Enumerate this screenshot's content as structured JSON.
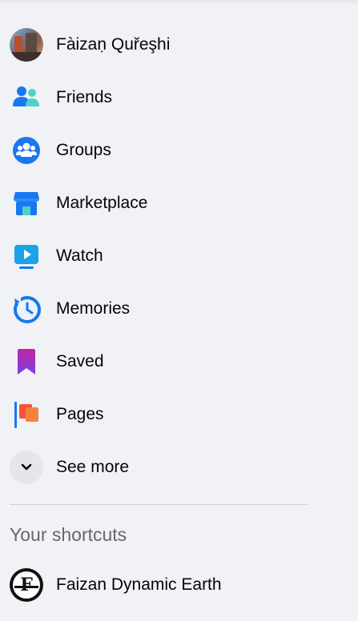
{
  "menu": {
    "items": [
      {
        "label": "Fàizaṇ Quřeşhi",
        "icon": "profile-avatar"
      },
      {
        "label": "Friends",
        "icon": "friends-icon"
      },
      {
        "label": "Groups",
        "icon": "groups-icon"
      },
      {
        "label": "Marketplace",
        "icon": "marketplace-icon"
      },
      {
        "label": "Watch",
        "icon": "watch-icon"
      },
      {
        "label": "Memories",
        "icon": "memories-icon"
      },
      {
        "label": "Saved",
        "icon": "saved-icon"
      },
      {
        "label": "Pages",
        "icon": "pages-icon"
      },
      {
        "label": "See more",
        "icon": "chevron-down-icon"
      }
    ]
  },
  "shortcuts": {
    "title": "Your shortcuts",
    "items": [
      {
        "label": "Faizan Dynamic Earth",
        "icon": "page-logo"
      }
    ]
  },
  "colors": {
    "background": "#f0f2f5",
    "text": "#050505",
    "secondary_text": "#65676b",
    "brand_blue": "#1877f2"
  }
}
